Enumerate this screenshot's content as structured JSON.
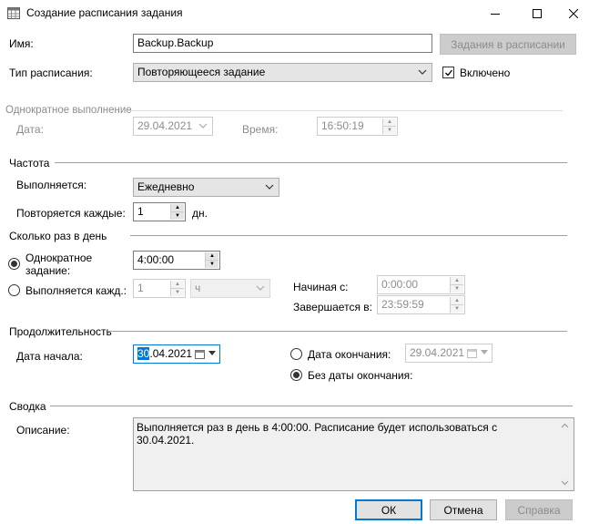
{
  "window": {
    "title": "Создание расписания задания"
  },
  "header": {
    "name_label": "Имя:",
    "name_value": "Backup.Backup",
    "jobs_in_schedule_button": "Задания в расписании",
    "schedule_type_label": "Тип расписания:",
    "schedule_type_value": "Повторяющееся задание",
    "enabled_label": "Включено",
    "enabled_checked": true
  },
  "one_time": {
    "group_label": "Однократное выполнение",
    "date_label": "Дата:",
    "date_value": "29.04.2021",
    "time_label": "Время:",
    "time_value": "16:50:19"
  },
  "frequency": {
    "group_label": "Частота",
    "occurs_label": "Выполняется:",
    "occurs_value": "Ежедневно",
    "recurs_label": "Повторяется каждые:",
    "recurs_value": "1",
    "recurs_unit": "дн."
  },
  "daily_frequency": {
    "group_label": "Сколько раз в день",
    "once_label_line1": "Однократное",
    "once_label_line2": "задание:",
    "once_value": "4:00:00",
    "once_selected": true,
    "every_label": "Выполняется кажд.:",
    "every_value": "1",
    "every_unit": "ч",
    "start_label": "Начиная с:",
    "start_value": "0:00:00",
    "end_label": "Завершается в:",
    "end_value": "23:59:59"
  },
  "duration": {
    "group_label": "Продолжительность",
    "start_date_label": "Дата начала:",
    "start_date_selected": "30",
    "start_date_rest": ".04.2021",
    "end_date_label": "Дата окончания:",
    "end_date_value": "29.04.2021",
    "no_end_label": "Без даты окончания:",
    "no_end_selected": true
  },
  "summary": {
    "group_label": "Сводка",
    "description_label": "Описание:",
    "description_text": "Выполняется раз в день в 4:00:00. Расписание будет использоваться с 30.04.2021."
  },
  "footer": {
    "ok": "ОК",
    "cancel": "Отмена",
    "help": "Справка"
  },
  "colors": {
    "accent": "#0078d7",
    "disabled_text": "#8c8c8c"
  },
  "icons": {
    "window": "calendar-grid-icon",
    "minimize": "minimize-icon",
    "maximize": "maximize-icon",
    "close": "close-icon"
  }
}
